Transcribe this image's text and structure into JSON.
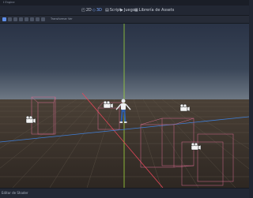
{
  "window": {
    "title": "t Engine"
  },
  "workspaces": [
    {
      "label": "2D",
      "icon": "2d-icon"
    },
    {
      "label": "3D",
      "icon": "3d-icon",
      "active": true
    },
    {
      "label": "Script",
      "icon": "script-icon"
    },
    {
      "label": "Juego",
      "icon": "play-icon"
    },
    {
      "label": "Librería de Assets",
      "icon": "assetlib-icon"
    }
  ],
  "toolbar": {
    "transform_label": "Transformar",
    "view_label": "Ver"
  },
  "bottom": {
    "shader_editor_label": "Editor de Shader"
  },
  "colors": {
    "accent": "#5e8ee8",
    "axis_x": "#e8465a",
    "axis_y": "#9cd43a",
    "axis_z": "#3f7fd8",
    "bounds": "#d66b8f"
  }
}
